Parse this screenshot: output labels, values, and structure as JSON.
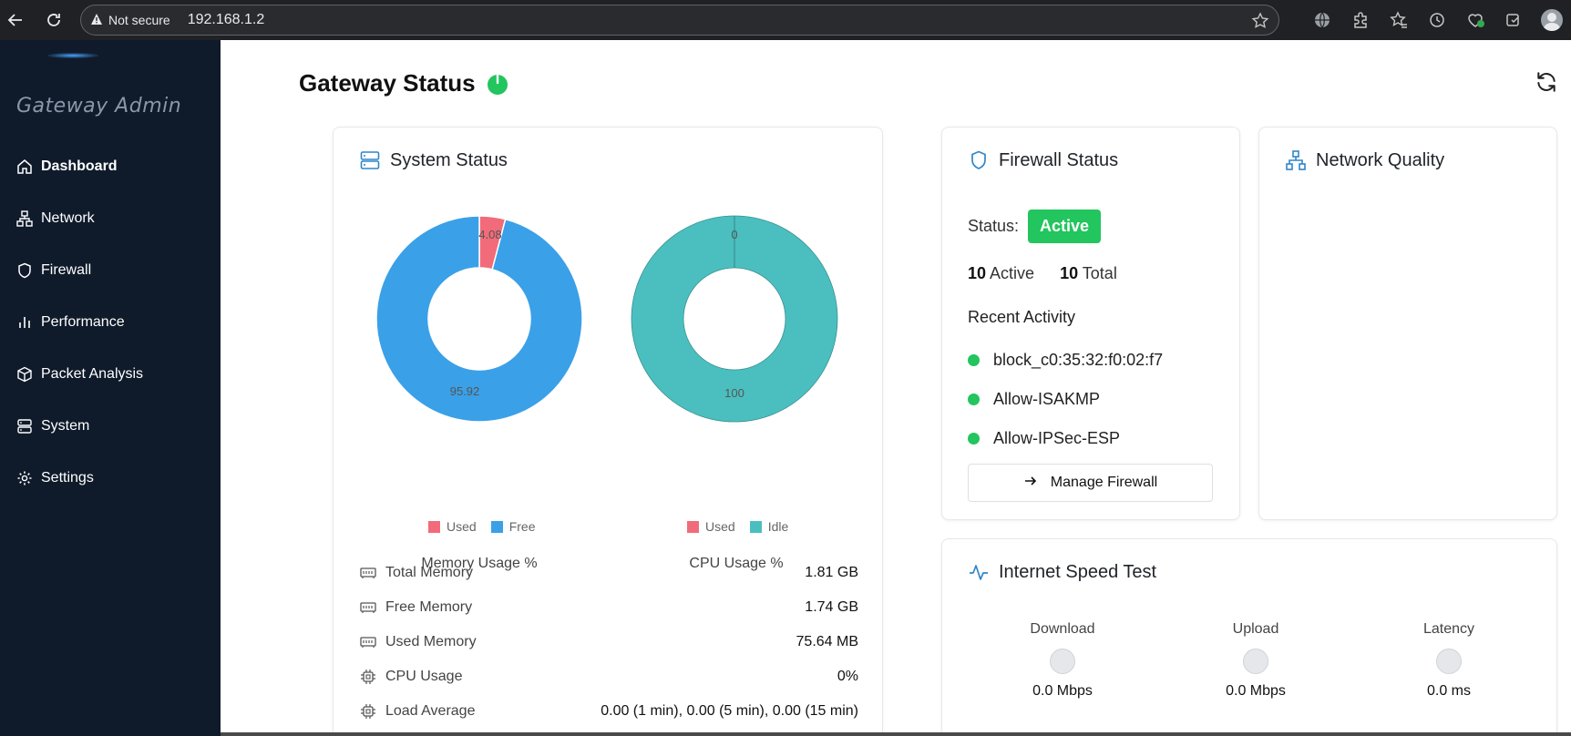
{
  "browser": {
    "security_label": "Not secure",
    "url": "192.168.1.2"
  },
  "sidebar": {
    "brand": "Gateway Admin",
    "items": [
      {
        "label": "Dashboard",
        "icon": "home-icon",
        "active": true
      },
      {
        "label": "Network",
        "icon": "network-icon",
        "active": false
      },
      {
        "label": "Firewall",
        "icon": "shield-icon",
        "active": false
      },
      {
        "label": "Performance",
        "icon": "bar-chart-icon",
        "active": false
      },
      {
        "label": "Packet Analysis",
        "icon": "package-icon",
        "active": false
      },
      {
        "label": "System",
        "icon": "server-icon",
        "active": false
      },
      {
        "label": "Settings",
        "icon": "gear-icon",
        "active": false
      }
    ]
  },
  "header": {
    "title": "Gateway Status",
    "status_color": "#22c55e"
  },
  "system_status": {
    "title": "System Status",
    "memory_caption": "Memory Usage %",
    "cpu_caption": "CPU Usage %",
    "memory_legend": [
      "Used",
      "Free"
    ],
    "cpu_legend": [
      "Used",
      "Idle"
    ],
    "stats": [
      {
        "label": "Total Memory",
        "value": "1.81 GB",
        "icon": "memory-icon"
      },
      {
        "label": "Free Memory",
        "value": "1.74 GB",
        "icon": "memory-icon"
      },
      {
        "label": "Used Memory",
        "value": "75.64 MB",
        "icon": "memory-icon"
      },
      {
        "label": "CPU Usage",
        "value": "0%",
        "icon": "cpu-icon"
      },
      {
        "label": "Load Average",
        "value": "0.00 (1 min), 0.00 (5 min), 0.00 (15 min)",
        "icon": "cpu-icon"
      }
    ]
  },
  "chart_data": [
    {
      "type": "pie",
      "categories": [
        "Used",
        "Free"
      ],
      "values": [
        4.08,
        95.92
      ],
      "data_labels": [
        "4.08",
        "95.92"
      ],
      "colors": [
        "#f26b7a",
        "#3aa0e8"
      ],
      "title": "Memory Usage %",
      "legend": "bottom"
    },
    {
      "type": "pie",
      "categories": [
        "Used",
        "Idle"
      ],
      "values": [
        0,
        100
      ],
      "data_labels": [
        "0",
        "100"
      ],
      "colors": [
        "#f26b7a",
        "#4bbfbf"
      ],
      "title": "CPU Usage %",
      "legend": "bottom"
    }
  ],
  "firewall": {
    "title": "Firewall Status",
    "status_label": "Status:",
    "status_value": "Active",
    "active_count": "10",
    "active_label": "Active",
    "total_count": "10",
    "total_label": "Total",
    "recent_title": "Recent Activity",
    "recent": [
      "block_c0:35:32:f0:02:f7",
      "Allow-ISAKMP",
      "Allow-IPSec-ESP"
    ],
    "button_label": "Manage Firewall",
    "accent": "#22c55e"
  },
  "network_quality": {
    "title": "Network Quality"
  },
  "speed_test": {
    "title": "Internet Speed Test",
    "metrics": [
      {
        "label": "Download",
        "value": "0.0 Mbps"
      },
      {
        "label": "Upload",
        "value": "0.0 Mbps"
      },
      {
        "label": "Latency",
        "value": "0.0 ms"
      }
    ]
  }
}
